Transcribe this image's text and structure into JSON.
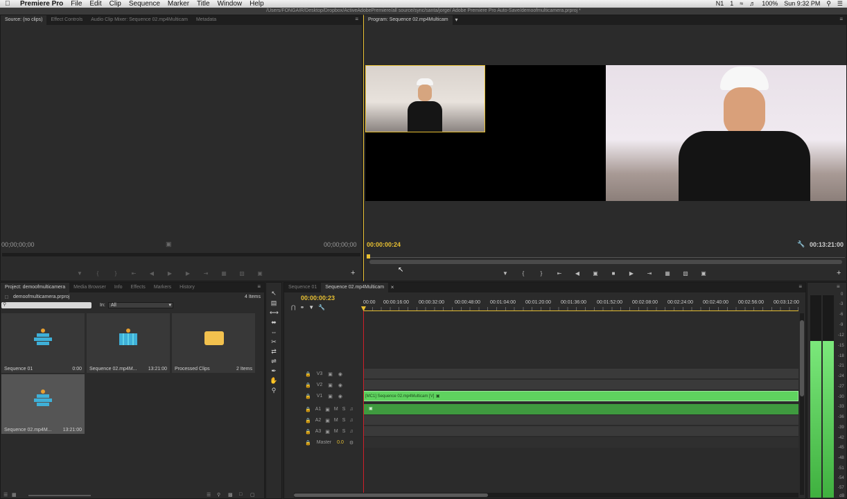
{
  "menubar": {
    "apple": "",
    "app_name": "Premiere Pro",
    "items": [
      "File",
      "Edit",
      "Clip",
      "Sequence",
      "Marker",
      "Title",
      "Window",
      "Help"
    ],
    "status": [
      "N1",
      "1",
      "100%",
      "Sun 9:32 PM",
      "Q"
    ]
  },
  "path_title": "/Users/FONGAIR/Desktop/Dropbox/ActiveAdobePremiere/all source/sync/santa/jorge/ Adobe Premiere Pro Auto-Save/demoofmulticamera.prproj *",
  "source_panel": {
    "tabs": [
      "Source: (no clips)",
      "Effect Controls",
      "Audio Clip Mixer: Sequence 02.mp4Multicam",
      "Metadata"
    ],
    "timecode_left": "00;00;00;00",
    "timecode_right": "00;00;00;00"
  },
  "program_panel": {
    "tab": "Program: Sequence 02.mp4Multicam",
    "timecode_current": "00:00:00:24",
    "timecode_duration": "00:13:21:00"
  },
  "project_panel": {
    "tabs": [
      "Project: demoofmulticamera",
      "Media Browser",
      "Info",
      "Effects",
      "Markers",
      "History"
    ],
    "project_file": "demoofmulticamera.prproj",
    "item_count": "4 Items",
    "in_label": "In:",
    "in_value": "All",
    "items": [
      {
        "name": "Sequence 01",
        "meta": "0:00",
        "icon": "sequence-icon"
      },
      {
        "name": "Sequence 02.mp4M...",
        "meta": "13:21:00",
        "icon": "multicam-sequence-icon"
      },
      {
        "name": "Processed Clips",
        "meta": "2 Items",
        "icon": "folder-icon"
      },
      {
        "name": "Sequence 02.mp4M...",
        "meta": "13:21:00",
        "icon": "sequence-icon"
      }
    ]
  },
  "timeline": {
    "tabs": [
      "Sequence 01",
      "Sequence 02.mp4Multicam"
    ],
    "timecode": "00:00:00:23",
    "ruler": [
      "00:00",
      "00:00:16:00",
      "00:00:32:00",
      "00:00:48:00",
      "00:01:04:00",
      "00:01:20:00",
      "00:01:36:00",
      "00:01:52:00",
      "00:02:08:00",
      "00:02:24:00",
      "00:02:40:00",
      "00:02:56:00",
      "00:03:12:00"
    ],
    "video_tracks": [
      "V3",
      "V2",
      "V1"
    ],
    "audio_tracks": [
      "A1",
      "A2",
      "A3"
    ],
    "master_label": "Master",
    "master_value": "0.0",
    "clip_label": "[MC1] Sequence 02.mp4Multicam [V]",
    "track_m": "M",
    "track_s": "S"
  },
  "meter_labels": [
    "0",
    "-3",
    "-6",
    "-9",
    "-12",
    "-15",
    "-18",
    "-21",
    "-24",
    "-27",
    "-30",
    "-33",
    "-36",
    "-39",
    "-42",
    "-45",
    "-48",
    "-51",
    "-54",
    "-57",
    "dB"
  ],
  "colors": {
    "accent_yellow": "#e8c032",
    "clip_green": "#5fd35f",
    "playhead_red": "#d0202a",
    "panel_bg": "#2b2b2b"
  }
}
